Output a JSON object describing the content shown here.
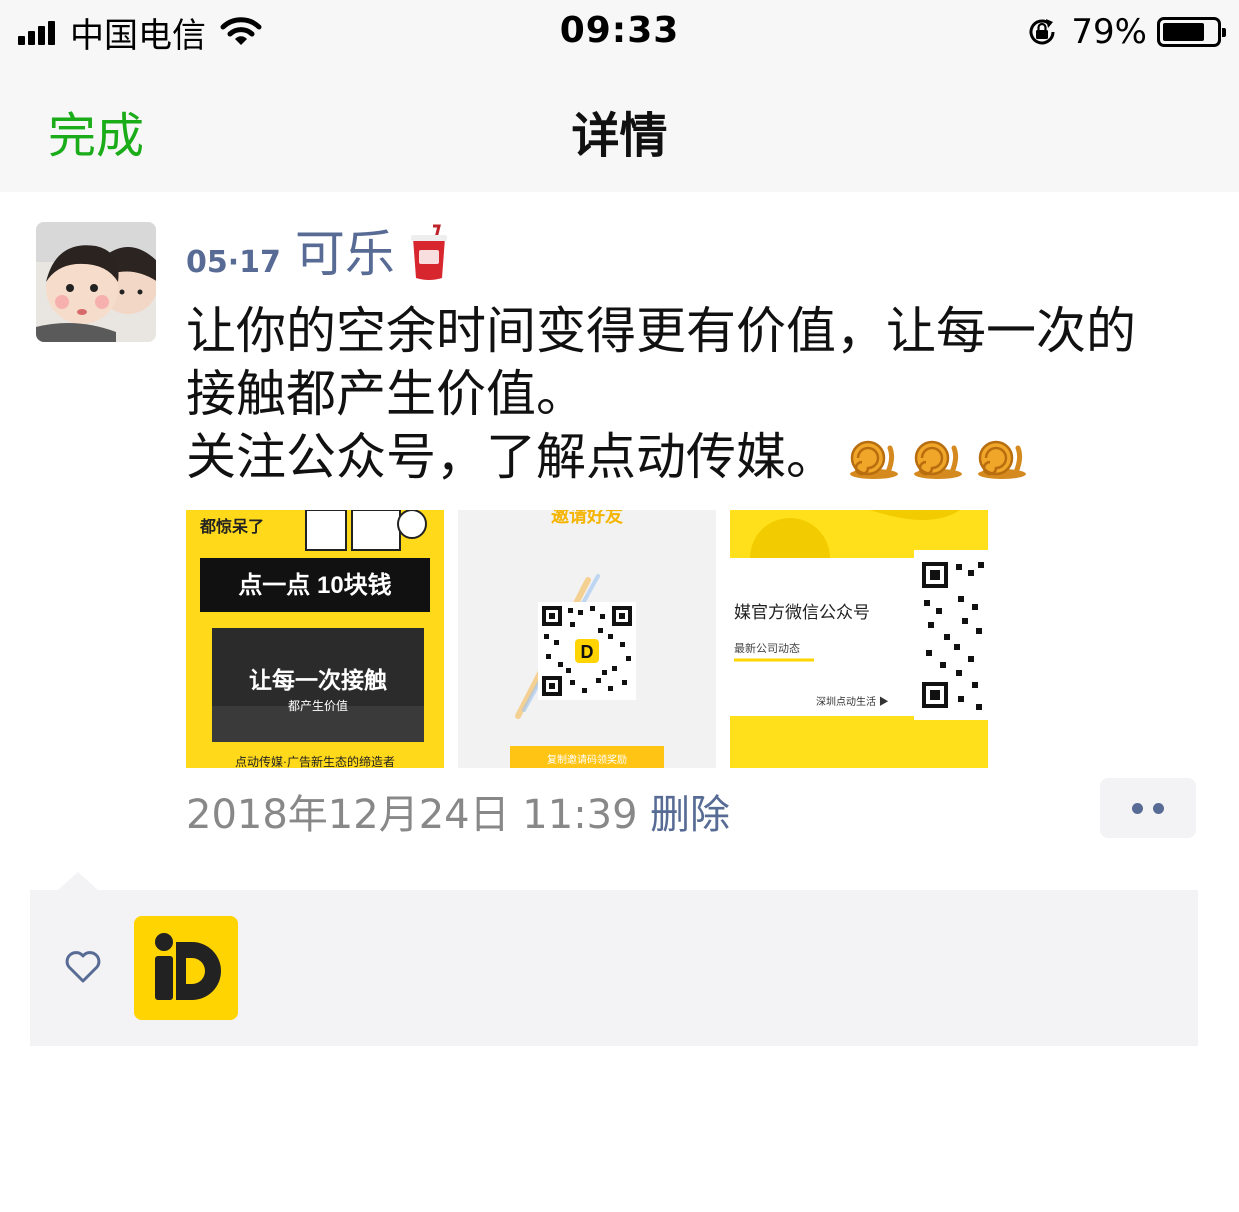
{
  "status_bar": {
    "carrier": "中国电信",
    "time": "09:33",
    "battery_percent": "79%",
    "battery_level": 0.79
  },
  "nav": {
    "done_label": "完成",
    "title": "详情"
  },
  "post": {
    "date_prefix": "05·17",
    "author": "可乐",
    "text_lines": [
      "让你的空余时间变得更有价值，让每一次的",
      "接触都产生价值。",
      "关注公众号，了解点动传媒。"
    ],
    "photos": [
      {
        "top_text": "都惊呆了",
        "banner": "点一点 10块钱",
        "headline": "让每一次接触",
        "subhead": "都产生价值",
        "footer": "点动传媒·广告新生态的缔造者"
      },
      {
        "top_text": "邀请好友",
        "footer": "复制邀请码领奖励"
      },
      {
        "title": "媒官方微信公众号",
        "subtitle": "最新公司动态",
        "footer": "深圳点动生活 ▶"
      }
    ],
    "timestamp": "2018年12月24日 11:39",
    "delete_label": "删除"
  },
  "colors": {
    "accent_green": "#1aad19",
    "link_blue": "#576b95",
    "brand_yellow": "#ffd400"
  },
  "icons": [
    "signal-icon",
    "wifi-icon",
    "lock-rotation-icon",
    "battery-icon",
    "cup-icon",
    "snail-icon",
    "heart-icon",
    "more-icon"
  ]
}
